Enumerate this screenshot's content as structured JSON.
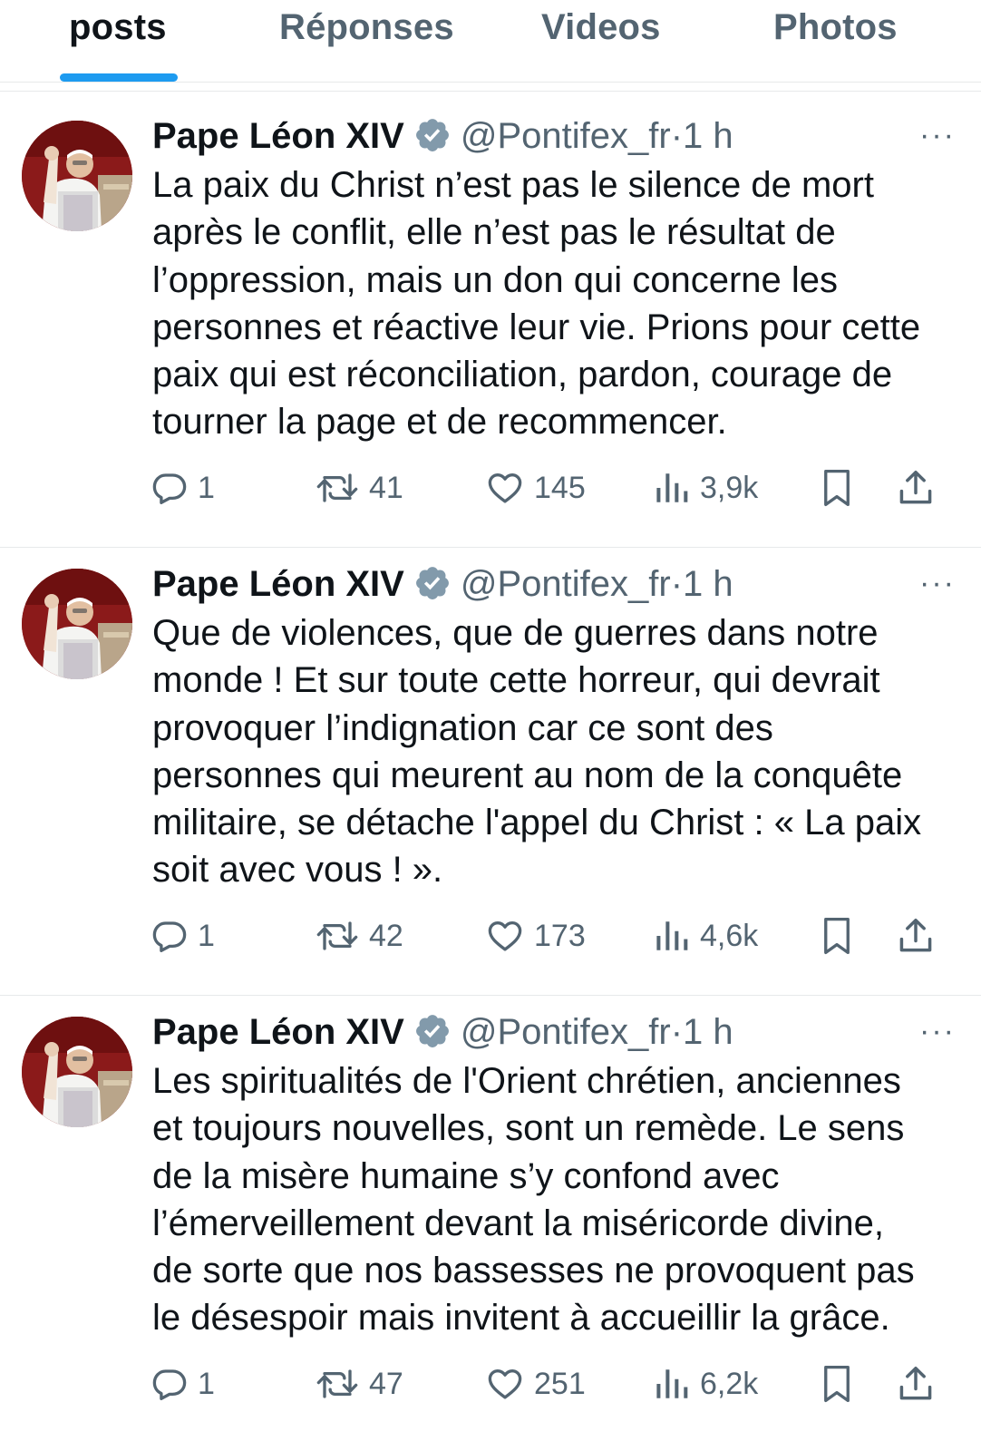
{
  "tabs": [
    {
      "label": "posts",
      "active": true
    },
    {
      "label": "Réponses",
      "active": false
    },
    {
      "label": "Videos",
      "active": false
    },
    {
      "label": "Photos",
      "active": false
    }
  ],
  "colors": {
    "accent": "#1d9bf0",
    "text_primary": "#0f1419",
    "text_secondary": "#536471",
    "divider": "#e7e9ea"
  },
  "posts": [
    {
      "author": {
        "name": "Pape Léon XIV",
        "handle": "@Pontifex_fr",
        "verified_icon": "verified-badge-icon"
      },
      "separator": "·",
      "time": "1 h",
      "more": "···",
      "text": "La paix du Christ n’est pas le silence de mort\naprès le conflit, elle n’est pas le résultat de\nl’oppression, mais un don qui concerne les\npersonnes et réactive leur vie. Prions pour cette\npaix qui est réconciliation, pardon, courage de\ntourner la page et de recommencer.",
      "stats": {
        "replies": "1",
        "reposts": "41",
        "likes": "145",
        "views": "3,9k"
      }
    },
    {
      "author": {
        "name": "Pape Léon XIV",
        "handle": "@Pontifex_fr",
        "verified_icon": "verified-badge-icon"
      },
      "separator": "·",
      "time": "1 h",
      "more": "···",
      "text": "Que de violences, que de guerres dans notre\nmonde ! Et sur toute cette horreur, qui devrait\nprovoquer l’indignation car ce sont des\npersonnes qui meurent au nom de la conquête\nmilitaire, se détache l'appel du Christ : « La paix\nsoit avec vous ! ».",
      "stats": {
        "replies": "1",
        "reposts": "42",
        "likes": "173",
        "views": "4,6k"
      }
    },
    {
      "author": {
        "name": "Pape Léon XIV",
        "handle": "@Pontifex_fr",
        "verified_icon": "verified-badge-icon"
      },
      "separator": "·",
      "time": "1 h",
      "more": "···",
      "text": "Les spiritualités de l'Orient chrétien, anciennes\net toujours nouvelles, sont un remède. Le sens\nde la misère humaine s’y confond avec\nl’émerveillement devant la miséricorde divine,\nde sorte que nos bassesses ne provoquent pas\nle désespoir mais invitent à accueillir la grâce.",
      "stats": {
        "replies": "1",
        "reposts": "47",
        "likes": "251",
        "views": "6,2k"
      }
    }
  ],
  "icons": {
    "reply": "reply-icon",
    "repost": "repost-icon",
    "like": "like-icon",
    "views": "views-icon",
    "bookmark": "bookmark-icon",
    "share": "share-icon"
  }
}
